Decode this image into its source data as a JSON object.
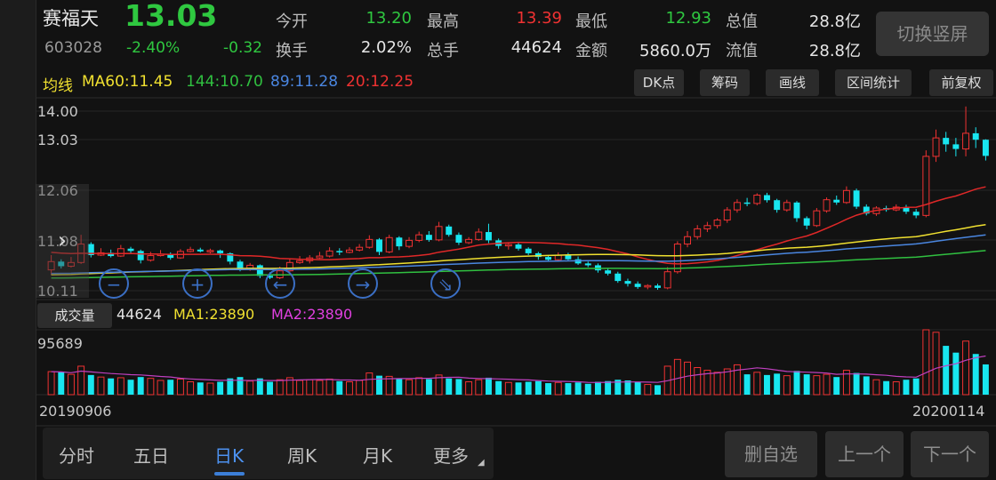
{
  "header": {
    "name": "赛福天",
    "code": "603028",
    "price": "13.03",
    "change_pct": "-2.40%",
    "change": "-0.32",
    "stats": [
      {
        "label": "今开",
        "value": "13.20",
        "color": "green"
      },
      {
        "label": "最高",
        "value": "13.39",
        "color": "red"
      },
      {
        "label": "最低",
        "value": "12.93",
        "color": "green"
      },
      {
        "label": "总值",
        "value": "28.8亿",
        "color": "white"
      },
      {
        "label": "换手",
        "value": "2.02%",
        "color": "white"
      },
      {
        "label": "总手",
        "value": "44624",
        "color": "white"
      },
      {
        "label": "金额",
        "value": "5860.0万",
        "color": "white"
      },
      {
        "label": "流值",
        "value": "28.8亿",
        "color": "white"
      }
    ],
    "toggle_label": "切换竖屏"
  },
  "ma": {
    "title": "均线",
    "ma60": "MA60:11.45",
    "ma144": "144:10.70",
    "ma89": "89:11.28",
    "ma20": "20:12.25"
  },
  "tools": [
    "DK点",
    "筹码",
    "画线",
    "区间统计",
    "前复权"
  ],
  "volume": {
    "button": "成交量",
    "value": "44624",
    "ma1": "MA1:23890",
    "ma2": "MA2:23890",
    "axis_max": "95689"
  },
  "chart_data": {
    "type": "candlestick",
    "y_ticks": [
      "14.00",
      "13.03",
      "12.06",
      "11.08",
      "10.11"
    ],
    "ylim": [
      10.11,
      14.0
    ],
    "start_date": "20190906",
    "end_date": "20200114",
    "colors": {
      "up": "#f03232",
      "down": "#18e6f0",
      "ma20": "#e02828",
      "ma60": "#f0e030",
      "ma89": "#4a86e0",
      "ma144": "#30c040",
      "vol_ma": "#c040c0"
    },
    "candles": [
      [
        10.56,
        10.74,
        10.88,
        10.45,
        34000
      ],
      [
        10.74,
        10.64,
        10.79,
        10.59,
        33000
      ],
      [
        10.64,
        10.72,
        10.84,
        10.61,
        30000
      ],
      [
        10.72,
        11.12,
        11.32,
        10.69,
        42000
      ],
      [
        11.12,
        10.88,
        11.16,
        10.83,
        29000
      ],
      [
        10.88,
        10.93,
        11.03,
        10.86,
        26000
      ],
      [
        10.93,
        10.86,
        11.0,
        10.83,
        24000
      ],
      [
        10.86,
        11.02,
        11.1,
        10.84,
        25000
      ],
      [
        11.02,
        10.97,
        11.06,
        10.92,
        22000
      ],
      [
        10.97,
        10.77,
        11.0,
        10.7,
        26000
      ],
      [
        10.77,
        10.87,
        10.95,
        10.74,
        24000
      ],
      [
        10.87,
        10.9,
        10.99,
        10.85,
        21000
      ],
      [
        10.9,
        10.82,
        10.94,
        10.78,
        22000
      ],
      [
        10.82,
        10.96,
        11.01,
        10.8,
        23000
      ],
      [
        10.96,
        11.0,
        11.06,
        10.94,
        19000
      ],
      [
        11.0,
        10.96,
        11.04,
        10.94,
        18000
      ],
      [
        10.96,
        10.98,
        11.02,
        10.92,
        17000
      ],
      [
        10.98,
        10.92,
        11.0,
        10.82,
        19000
      ],
      [
        10.92,
        10.74,
        10.94,
        10.68,
        24000
      ],
      [
        10.74,
        10.58,
        10.78,
        10.53,
        26000
      ],
      [
        10.58,
        10.66,
        10.71,
        10.54,
        20000
      ],
      [
        10.66,
        10.43,
        10.68,
        10.38,
        24000
      ],
      [
        10.43,
        10.39,
        10.51,
        10.36,
        19000
      ],
      [
        10.39,
        10.54,
        10.63,
        10.36,
        22000
      ],
      [
        10.54,
        10.72,
        10.81,
        10.52,
        25000
      ],
      [
        10.72,
        10.76,
        10.86,
        10.69,
        21000
      ],
      [
        10.76,
        10.82,
        10.88,
        10.7,
        22000
      ],
      [
        10.82,
        10.86,
        10.95,
        10.8,
        21000
      ],
      [
        10.86,
        10.97,
        11.05,
        10.83,
        23000
      ],
      [
        10.97,
        10.94,
        11.03,
        10.88,
        20000
      ],
      [
        10.94,
        10.99,
        11.05,
        10.92,
        19000
      ],
      [
        10.99,
        11.05,
        11.12,
        10.96,
        21000
      ],
      [
        11.05,
        11.22,
        11.31,
        11.02,
        32000
      ],
      [
        11.22,
        10.95,
        11.25,
        10.88,
        28000
      ],
      [
        10.95,
        11.26,
        11.32,
        10.92,
        27000
      ],
      [
        11.26,
        11.07,
        11.29,
        10.99,
        24000
      ],
      [
        11.07,
        11.2,
        11.27,
        11.03,
        22000
      ],
      [
        11.2,
        11.32,
        11.39,
        11.16,
        25000
      ],
      [
        11.32,
        11.21,
        11.4,
        11.17,
        23000
      ],
      [
        11.21,
        11.5,
        11.6,
        11.18,
        29000
      ],
      [
        11.5,
        11.32,
        11.54,
        11.28,
        24000
      ],
      [
        11.32,
        11.15,
        11.37,
        11.1,
        23000
      ],
      [
        11.15,
        11.22,
        11.27,
        11.12,
        19000
      ],
      [
        11.22,
        11.38,
        11.46,
        11.19,
        22000
      ],
      [
        11.38,
        11.2,
        11.56,
        11.14,
        25000
      ],
      [
        11.2,
        11.08,
        11.24,
        11.02,
        20000
      ],
      [
        11.08,
        11.11,
        11.15,
        11.0,
        18000
      ],
      [
        11.11,
        11.02,
        11.14,
        10.98,
        18000
      ],
      [
        11.02,
        10.92,
        11.05,
        10.88,
        19000
      ],
      [
        10.92,
        10.84,
        10.95,
        10.78,
        20000
      ],
      [
        10.84,
        10.78,
        10.88,
        10.74,
        17000
      ],
      [
        10.78,
        10.88,
        10.94,
        10.76,
        18000
      ],
      [
        10.88,
        10.79,
        10.93,
        10.77,
        17000
      ],
      [
        10.79,
        10.7,
        10.85,
        10.67,
        18000
      ],
      [
        10.7,
        10.66,
        10.74,
        10.62,
        16000
      ],
      [
        10.66,
        10.55,
        10.7,
        10.5,
        19000
      ],
      [
        10.55,
        10.48,
        10.59,
        10.44,
        20000
      ],
      [
        10.48,
        10.32,
        10.52,
        10.28,
        22000
      ],
      [
        10.32,
        10.26,
        10.37,
        10.2,
        21000
      ],
      [
        10.26,
        10.19,
        10.31,
        10.15,
        19000
      ],
      [
        10.19,
        10.22,
        10.25,
        10.14,
        15000
      ],
      [
        10.22,
        10.17,
        10.26,
        10.13,
        14000
      ],
      [
        10.17,
        10.52,
        10.62,
        10.14,
        42000
      ],
      [
        10.52,
        11.12,
        11.18,
        10.48,
        52000
      ],
      [
        11.12,
        11.28,
        11.4,
        11.05,
        48000
      ],
      [
        11.28,
        11.45,
        11.53,
        11.22,
        40000
      ],
      [
        11.45,
        11.52,
        11.6,
        11.38,
        36000
      ],
      [
        11.52,
        11.64,
        11.68,
        11.46,
        33000
      ],
      [
        11.64,
        11.86,
        11.92,
        11.58,
        38000
      ],
      [
        11.86,
        12.02,
        12.09,
        11.8,
        44000
      ],
      [
        12.02,
        12.0,
        12.12,
        11.94,
        30000
      ],
      [
        12.0,
        12.18,
        12.22,
        11.96,
        33000
      ],
      [
        12.18,
        12.07,
        12.23,
        12.02,
        29000
      ],
      [
        12.07,
        11.86,
        12.1,
        11.8,
        31000
      ],
      [
        11.86,
        12.02,
        12.08,
        11.82,
        28000
      ],
      [
        12.02,
        11.68,
        12.05,
        11.6,
        35000
      ],
      [
        11.68,
        11.52,
        11.72,
        11.44,
        30000
      ],
      [
        11.52,
        11.84,
        11.9,
        11.49,
        28000
      ],
      [
        11.84,
        12.08,
        12.13,
        11.8,
        30000
      ],
      [
        12.08,
        12.02,
        12.17,
        11.97,
        26000
      ],
      [
        12.02,
        12.28,
        12.37,
        11.99,
        36000
      ],
      [
        12.28,
        11.93,
        12.32,
        11.88,
        32000
      ],
      [
        11.93,
        11.78,
        11.98,
        11.74,
        27000
      ],
      [
        11.78,
        11.9,
        11.94,
        11.73,
        22000
      ],
      [
        11.9,
        11.86,
        11.95,
        11.82,
        20000
      ],
      [
        11.86,
        11.92,
        11.98,
        11.83,
        19000
      ],
      [
        11.92,
        11.82,
        11.97,
        11.77,
        22000
      ],
      [
        11.82,
        11.74,
        11.88,
        11.68,
        24000
      ],
      [
        11.74,
        13.02,
        13.15,
        11.7,
        95689
      ],
      [
        13.02,
        13.42,
        13.6,
        12.9,
        92000
      ],
      [
        13.42,
        13.28,
        13.55,
        13.12,
        72000
      ],
      [
        13.28,
        13.18,
        13.42,
        13.02,
        62000
      ],
      [
        13.18,
        13.52,
        14.1,
        13.02,
        79000
      ],
      [
        13.52,
        13.38,
        13.65,
        13.2,
        60000
      ],
      [
        13.38,
        13.03,
        13.39,
        12.93,
        44624
      ]
    ]
  },
  "tabs": [
    "分时",
    "五日",
    "日K",
    "周K",
    "月K",
    "更多"
  ],
  "active_tab": "日K",
  "nav": {
    "fav": "删自选",
    "prev": "上一个",
    "next": "下一个"
  }
}
